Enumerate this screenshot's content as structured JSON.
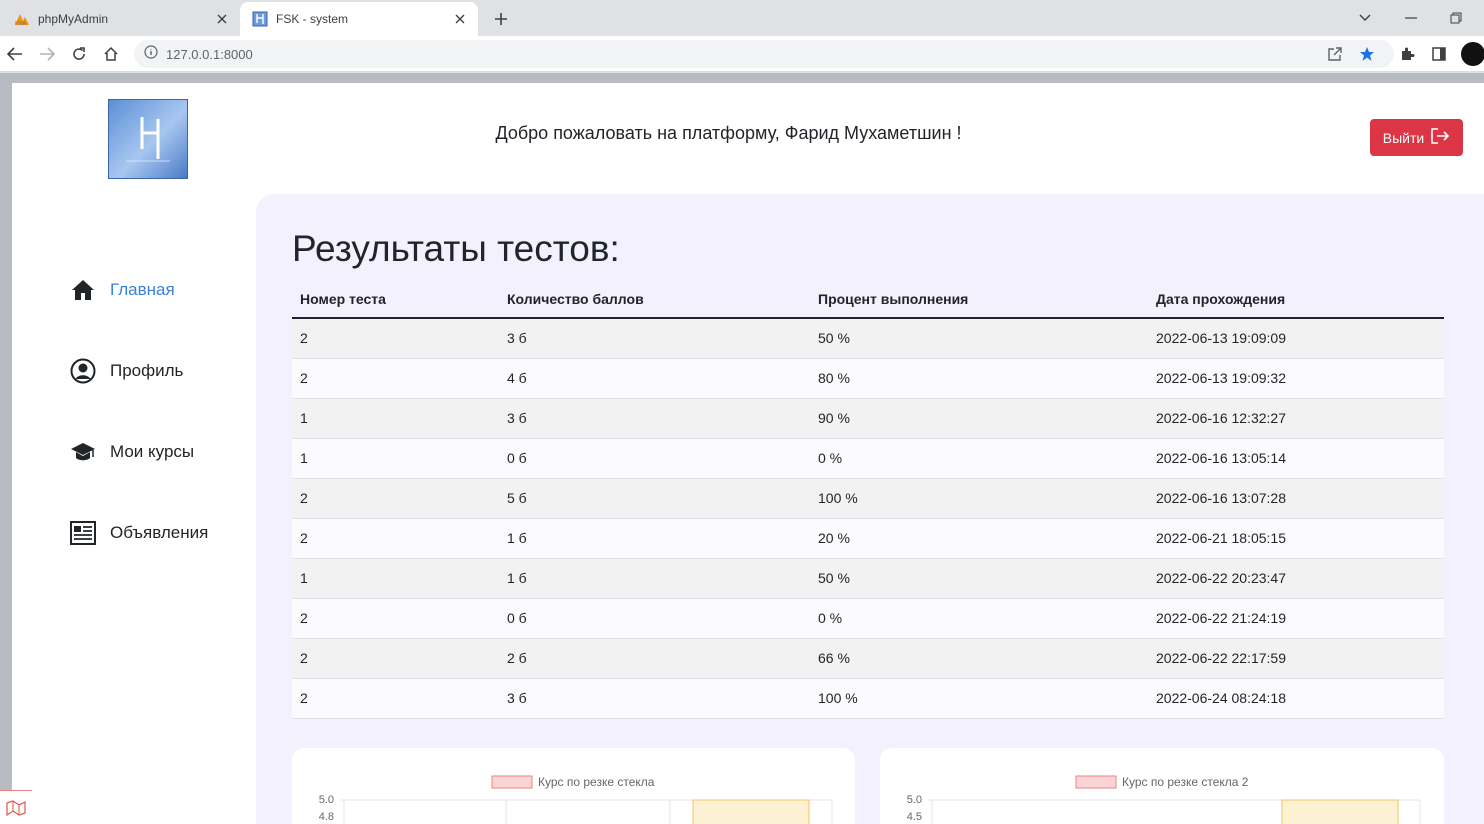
{
  "browser": {
    "tabs": [
      {
        "title": "phpMyAdmin",
        "icon": "phpmyadmin-icon",
        "active": false
      },
      {
        "title": "FSK - system",
        "icon": "fsk-favicon-icon",
        "active": true
      }
    ],
    "url": "127.0.0.1:8000"
  },
  "header": {
    "welcome": "Добро пожаловать на платформу, Фарид Мухаметшин !",
    "logout_label": "Выйти"
  },
  "sidebar": {
    "items": [
      {
        "label": "Главная",
        "icon": "home-icon",
        "active": true
      },
      {
        "label": "Профиль",
        "icon": "user-circle-icon",
        "active": false
      },
      {
        "label": "Мои курсы",
        "icon": "graduation-cap-icon",
        "active": false
      },
      {
        "label": "Объявления",
        "icon": "newspaper-icon",
        "active": false
      }
    ]
  },
  "results": {
    "title": "Результаты тестов:",
    "columns": [
      "Номер теста",
      "Количество баллов",
      "Процент выполнения",
      "Дата прохождения"
    ],
    "rows": [
      [
        "2",
        "3 б",
        "50 %",
        "2022-06-13 19:09:09"
      ],
      [
        "2",
        "4 б",
        "80 %",
        "2022-06-13 19:09:32"
      ],
      [
        "1",
        "3 б",
        "90 %",
        "2022-06-16 12:32:27"
      ],
      [
        "1",
        "0 б",
        "0 %",
        "2022-06-16 13:05:14"
      ],
      [
        "2",
        "5 б",
        "100 %",
        "2022-06-16 13:07:28"
      ],
      [
        "2",
        "1 б",
        "20 %",
        "2022-06-21 18:05:15"
      ],
      [
        "1",
        "1 б",
        "50 %",
        "2022-06-22 20:23:47"
      ],
      [
        "2",
        "0 б",
        "0 %",
        "2022-06-22 21:24:19"
      ],
      [
        "2",
        "2 б",
        "66 %",
        "2022-06-22 22:17:59"
      ],
      [
        "2",
        "3 б",
        "100 %",
        "2022-06-24 08:24:18"
      ]
    ]
  },
  "chart_data": [
    {
      "type": "bar",
      "series": [
        {
          "name": "Курс по резке стекла"
        }
      ],
      "yticks": [
        "5.0",
        "4.8"
      ]
    },
    {
      "type": "bar",
      "series": [
        {
          "name": "Курс по резке стекла 2"
        }
      ],
      "yticks": [
        "5.0",
        "4.5"
      ]
    }
  ],
  "colors": {
    "accent": "#3b82d6",
    "danger": "#dc3545",
    "content_bg": "#f3f1fe",
    "legend_fill": "#fbd5d5",
    "legend_border": "#f08080",
    "bar_fill": "#fdf1d3",
    "bar_border": "#f5c46a"
  }
}
